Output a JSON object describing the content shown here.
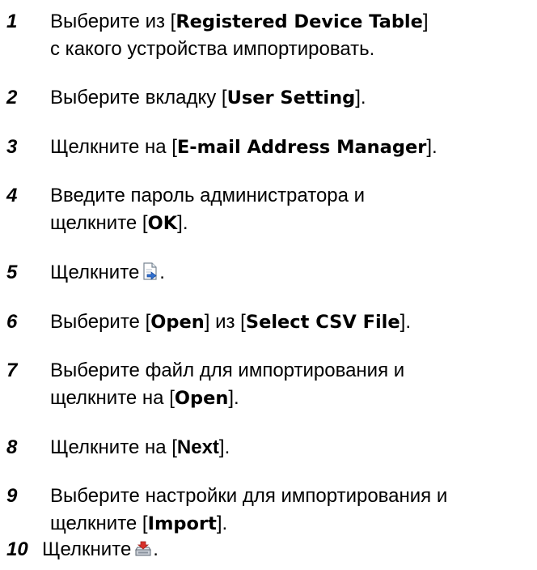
{
  "steps": [
    {
      "number": "1",
      "line1_before": "Выберите из [",
      "line1_bold": "Registered Device Table",
      "line1_after": "]",
      "line2": "с какого устройства импортировать."
    },
    {
      "number": "2",
      "before": "Выберите вкладку [",
      "bold": "User Setting",
      "after": "]."
    },
    {
      "number": "3",
      "before": "Щелкните на [",
      "bold": "E-mail Address Manager",
      "after": "]."
    },
    {
      "number": "4",
      "line1": "Введите пароль администратора и",
      "line2_before": "щелкните [",
      "line2_bold": "OK",
      "line2_after": "]."
    },
    {
      "number": "5",
      "before": "Щелкните",
      "icon": "import-document-icon",
      "after": "."
    },
    {
      "number": "6",
      "before": "Выберите [",
      "bold1": "Open",
      "middle": "] из [",
      "bold2": "Select CSV File",
      "after": "]."
    },
    {
      "number": "7",
      "line1": "Выберите файл для импортирования и",
      "line2_before": "щелкните на [",
      "line2_bold": "Open",
      "line2_after": "]."
    },
    {
      "number": "8",
      "before": "Щелкните на [",
      "bold": "Next",
      "after": "]."
    },
    {
      "number": "9",
      "line1": "Выберите настройки для импортирования и",
      "line2_before": "щелкните [",
      "line2_bold": "Import",
      "line2_after": "]."
    },
    {
      "number": "10",
      "before": "Щелкните",
      "icon": "device-write-icon",
      "after": "."
    }
  ],
  "colors": {
    "text": "#000000",
    "icon_blue": "#2f6fd0",
    "icon_red": "#d8302a"
  }
}
